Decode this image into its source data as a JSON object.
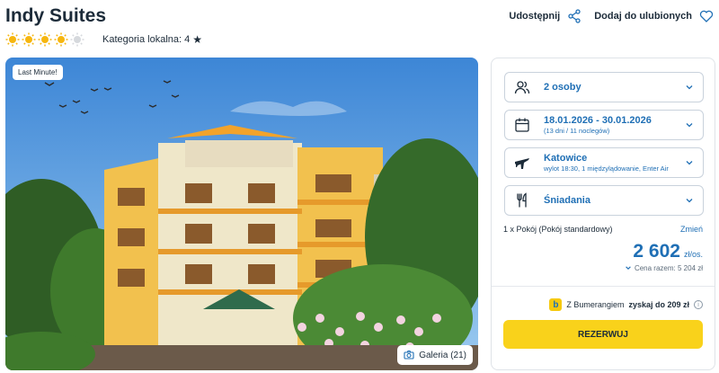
{
  "hotel": {
    "name": "Indy Suites",
    "sun_rating": 4,
    "sun_max": 5,
    "category_text": "Kategoria lokalna: 4"
  },
  "actions": {
    "share_label": "Udostępnij",
    "favorite_label": "Dodaj do ulubionych"
  },
  "photo": {
    "badge": "Last Minute!",
    "gallery_label": "Galeria (21)"
  },
  "booking": {
    "travelers": "2 osoby",
    "dates": "18.01.2026 - 30.01.2026",
    "dates_sub": "(13 dni / 11 noclegów)",
    "departure_city": "Katowice",
    "departure_sub": "wylot 18:30, 1 międzylądowanie, Enter Air",
    "board": "Śniadania",
    "room": "1 x Pokój  (Pokój standardowy)",
    "change_label": "Zmień",
    "price": "2 602",
    "price_unit": "zł/os.",
    "total": "Cena razem: 5 204 zł",
    "bumerang_prefix": "Z Bumerangiem",
    "bumerang_bold": "zyskaj do 209 zł",
    "book_label": "REZERWUJ"
  },
  "colors": {
    "accent": "#1f6fb5",
    "button": "#f9d21b",
    "sun": "#f6b60f"
  }
}
